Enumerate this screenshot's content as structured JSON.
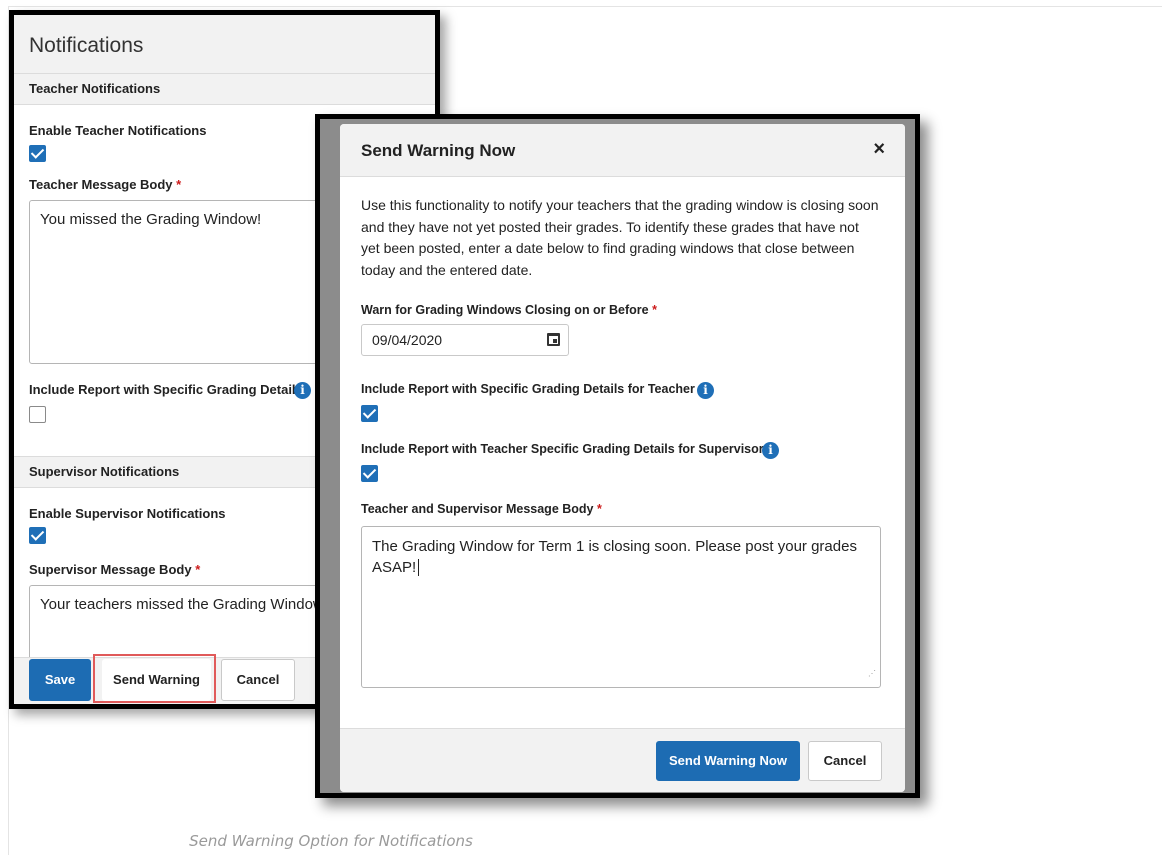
{
  "caption": "Send Warning Option for Notifications",
  "notifications_panel": {
    "title": "Notifications",
    "teacher_section": {
      "heading": "Teacher Notifications",
      "enable_label": "Enable Teacher Notifications",
      "enable_checked": true,
      "message_label": "Teacher Message Body",
      "required_mark": "*",
      "message_value": "You missed the Grading Window!",
      "include_report_label": "Include Report with Specific Grading Details",
      "include_report_checked": false
    },
    "supervisor_section": {
      "heading": "Supervisor Notifications",
      "enable_label": "Enable Supervisor Notifications",
      "enable_checked": true,
      "message_label": "Supervisor Message Body",
      "required_mark": "*",
      "message_value": "Your teachers missed the Grading Window"
    },
    "buttons": {
      "save": "Save",
      "send_warning": "Send Warning",
      "cancel": "Cancel"
    }
  },
  "modal": {
    "title": "Send Warning Now",
    "close": "×",
    "description": "Use this functionality to notify your teachers that the grading window is closing soon and they have not yet posted their grades. To identify these grades that have not yet been posted, enter a date below to find grading windows that close between today and the entered date.",
    "date_label": "Warn for Grading Windows Closing on or Before",
    "required_mark": "*",
    "date_value": "09/04/2020",
    "include_teacher_label": "Include Report with Specific Grading Details for Teacher",
    "include_teacher_checked": true,
    "include_supervisor_label": "Include Report with Teacher Specific Grading Details for Supervisor",
    "include_supervisor_checked": true,
    "message_label": "Teacher and Supervisor Message Body",
    "message_value": "The Grading Window for Term 1 is closing soon. Please post your grades ASAP!",
    "buttons": {
      "send_warning_now": "Send Warning Now",
      "cancel": "Cancel"
    }
  },
  "colors": {
    "primary_button": "#1d6cb3",
    "checkbox": "#1f6fb7",
    "required": "#cc1a1a",
    "highlight": "#e05a5a"
  }
}
